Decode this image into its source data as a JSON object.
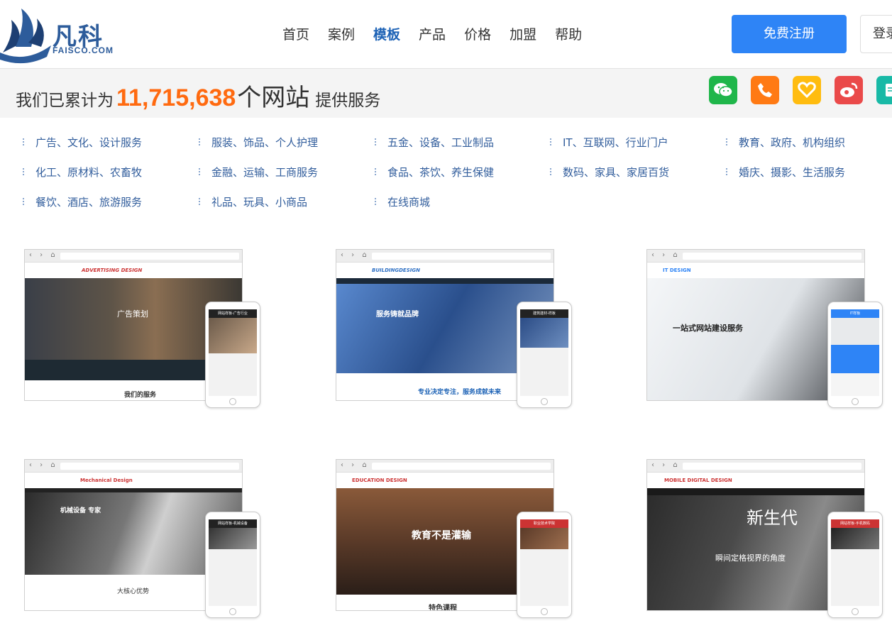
{
  "header": {
    "logo_cn": "凡科",
    "logo_en": "FAISCO.COM",
    "nav": [
      "首页",
      "案例",
      "模板",
      "产品",
      "价格",
      "加盟",
      "帮助"
    ],
    "active_nav": "模板",
    "register_label": "免费注册",
    "login_label": "登录"
  },
  "stats": {
    "prefix": "我们已累计为",
    "count": "11,715,638",
    "unit": "个网站",
    "suffix": "提供服务"
  },
  "social_icons": [
    {
      "name": "wechat-icon",
      "color": "#1fb64a"
    },
    {
      "name": "phone-icon",
      "color": "#ff7a14"
    },
    {
      "name": "favorite-heart-icon",
      "color": "#ffbc0f"
    },
    {
      "name": "weibo-icon",
      "color": "#ea4a4a"
    },
    {
      "name": "notepad-icon",
      "color": "#18b9a6"
    }
  ],
  "categories": [
    "广告、文化、设计服务",
    "服装、饰品、个人护理",
    "五金、设备、工业制品",
    "IT、互联网、行业门户",
    "教育、政府、机构组织",
    "化工、原材料、农畜牧",
    "金融、运输、工商服务",
    "食品、茶饮、养生保健",
    "数码、家具、家居百货",
    "婚庆、摄影、生活服务",
    "餐饮、酒店、旅游服务",
    "礼品、玩具、小商品",
    "在线商城"
  ],
  "templates": [
    {
      "brand": "ADVERTISING DESIGN",
      "hero": "广告策划",
      "footer": "我们的服务",
      "phone_title": "网站样板-广告行业"
    },
    {
      "brand": "BUILDINGDESIGN",
      "hero": "服务铸就品牌",
      "footer": "专业决定专注，服务成就未来",
      "phone_title": "建筑建材-样板"
    },
    {
      "brand": "IT DESIGN",
      "hero": "一站式网站建设服务",
      "footer": "",
      "phone_title": "IT样板"
    },
    {
      "brand": "Mechanical Design",
      "hero": "机械设备 专家",
      "footer": "大核心优势",
      "phone_title": "网站样板-机械设备"
    },
    {
      "brand": "EDUCATION DESIGN",
      "hero": "教育不是灌输",
      "footer": "特色课程",
      "phone_title": "职业技术学院"
    },
    {
      "brand": "MOBILE DIGITAL DESIGN",
      "hero": "新生代",
      "footer": "瞬间定格视界的角度",
      "phone_title": "网站样板-手机数码"
    }
  ]
}
